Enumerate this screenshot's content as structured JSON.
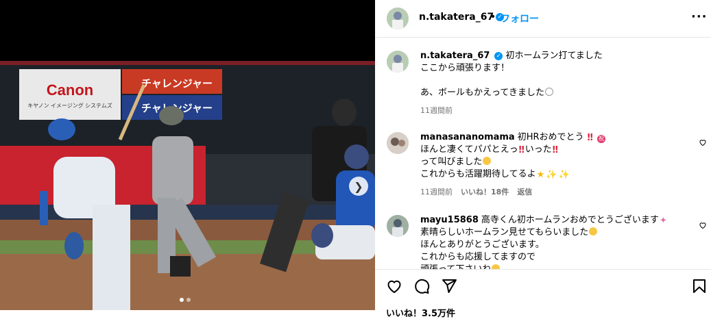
{
  "media": {
    "signs": [
      "Canon",
      "キヤノン イメージング システムズ",
      "チャレンジャー",
      "チャレンジャー"
    ],
    "carousel": {
      "count": 2,
      "active": 0
    }
  },
  "header": {
    "username": "n.takatera_67",
    "separator": "•",
    "follow_label": "フォロー"
  },
  "caption": {
    "username": "n.takatera_67",
    "lines": [
      "初ホームラン打てました",
      "ここから頑張ります！",
      "",
      "あ、ボールもかえってきました"
    ],
    "time": "11週間前"
  },
  "comments": [
    {
      "username": "manasananomama",
      "lines": [
        "初HRおめでとう",
        "ほんと凄くてパパとえっ",
        "いった",
        "って叫びました",
        "これからも活躍期待してるよ"
      ],
      "time": "11週間前",
      "likes": "いいね！18件",
      "reply": "返信"
    },
    {
      "username": "mayu15868",
      "lines": [
        "高寺くん初ホームランおめでとうございます",
        "素晴らしいホームラン見せてもらいました",
        "ほんとありがとうございます。",
        "これからも応援してますので",
        "頑張って下さいね"
      ]
    }
  ],
  "footer": {
    "likes": "いいね！3.5万件"
  },
  "icons": [
    "verified-badge",
    "more-icon",
    "heart-icon",
    "comment-icon",
    "share-icon",
    "bookmark-icon",
    "chevron-right-icon"
  ],
  "colors": {
    "accent": "#0095f6",
    "muted": "#737373"
  }
}
